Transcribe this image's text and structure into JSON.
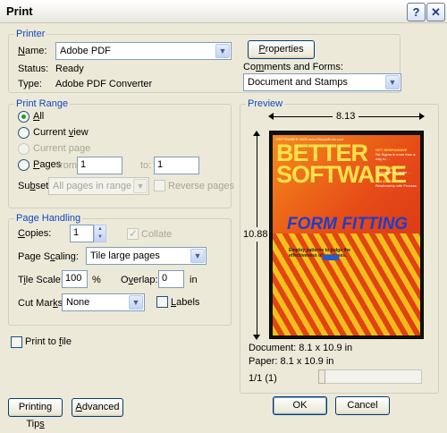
{
  "window": {
    "title": "Print",
    "help_label": "?",
    "close_label": "✕"
  },
  "printer": {
    "group_label": "Printer",
    "name_label": "Name:",
    "name_value": "Adobe PDF",
    "properties_label": "Properties",
    "status_label": "Status:",
    "status_value": "Ready",
    "type_label": "Type:",
    "type_value": "Adobe PDF Converter",
    "comments_label": "Comments and Forms:",
    "comments_value": "Document and Stamps"
  },
  "print_range": {
    "group_label": "Print Range",
    "all_label": "All",
    "current_view_label": "Current view",
    "current_page_label": "Current page",
    "pages_label": "Pages",
    "from_label": "from:",
    "from_value": "1",
    "to_label": "to:",
    "to_value": "1",
    "subset_label": "Subset:",
    "subset_value": "All pages in range",
    "reverse_label": "Reverse pages"
  },
  "page_handling": {
    "group_label": "Page Handling",
    "copies_label": "Copies:",
    "copies_value": "1",
    "collate_label": "Collate",
    "scaling_label": "Page Scaling:",
    "scaling_value": "Tile large pages",
    "tile_scale_label": "Tile Scale:",
    "tile_scale_value": "100",
    "tile_scale_unit": "%",
    "overlap_label": "Overlap:",
    "overlap_value": "0",
    "overlap_unit": "in",
    "cut_marks_label": "Cut Marks:",
    "cut_marks_value": "None",
    "labels_label": "Labels"
  },
  "print_to_file_label": "Print to file",
  "preview": {
    "group_label": "Preview",
    "width_value": "8.13",
    "height_value": "10.88",
    "document_label": "Document: 8.1 x 10.9 in",
    "paper_label": "Paper: 8.1 x 10.9 in",
    "page_counter": "1/1 (1)",
    "thumbnail": {
      "top_line": "SEPTEMBER 2005  www.StickyMinds.com",
      "title": "BETTER SOFTWARE",
      "side_1_head": "GET RESPONSIVE",
      "side_1_text": "Six Sigma is more than a way to ...",
      "side_2_head": "PROCESS THAT",
      "side_2_text": "Technique for better ...",
      "side_3_head": "ROLES AT",
      "side_3_text": "Relationship with Process",
      "headline": "FORM FITTING",
      "subtitle": "Employ patterns to judge the effectiveness of use cases."
    }
  },
  "buttons": {
    "printing_tips": "Printing Tips",
    "advanced": "Advanced",
    "ok": "OK",
    "cancel": "Cancel"
  }
}
